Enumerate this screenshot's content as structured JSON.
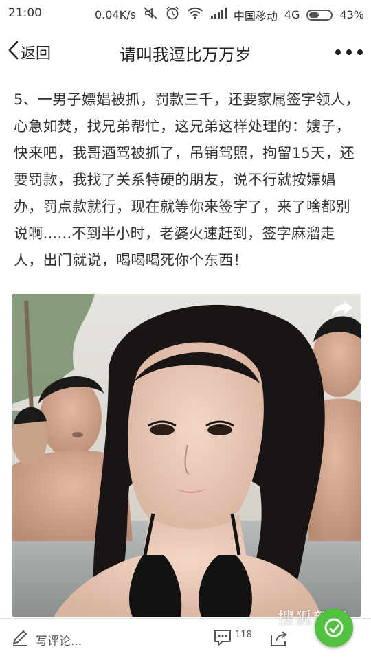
{
  "status_bar": {
    "time": "21:00",
    "network_speed": "0.04K/s",
    "carrier": "中国移动",
    "network_type": "4G",
    "battery": "43%",
    "icons": [
      "mute-icon",
      "alarm-icon",
      "wifi-icon",
      "signal-icon",
      "battery-icon"
    ]
  },
  "nav": {
    "back_label": "返回",
    "title": "请叫我逗比万万岁"
  },
  "article": {
    "text": "5、一男子嫖娼被抓，罚款三千，还要家属签字领人，心急如焚，找兄弟帮忙，这兄弟这样处理的：嫂子，快来吧，我哥酒驾被抓了，吊销驾照，拘留15天，还要罚款，我找了关系特硬的朋友，说不行就按嫖娼办，罚点款就行，现在就等你来签字了，来了啥都别说啊......不到半小时，老婆火速赶到，签字麻溜走人，出门就说，喝喝喝死你个东西！"
  },
  "bottom_bar": {
    "comment_placeholder": "写评论...",
    "comment_count": "118",
    "watermark": "搜狐新闻"
  },
  "colors": {
    "fab_green": "#52c13f",
    "text": "#333333"
  }
}
